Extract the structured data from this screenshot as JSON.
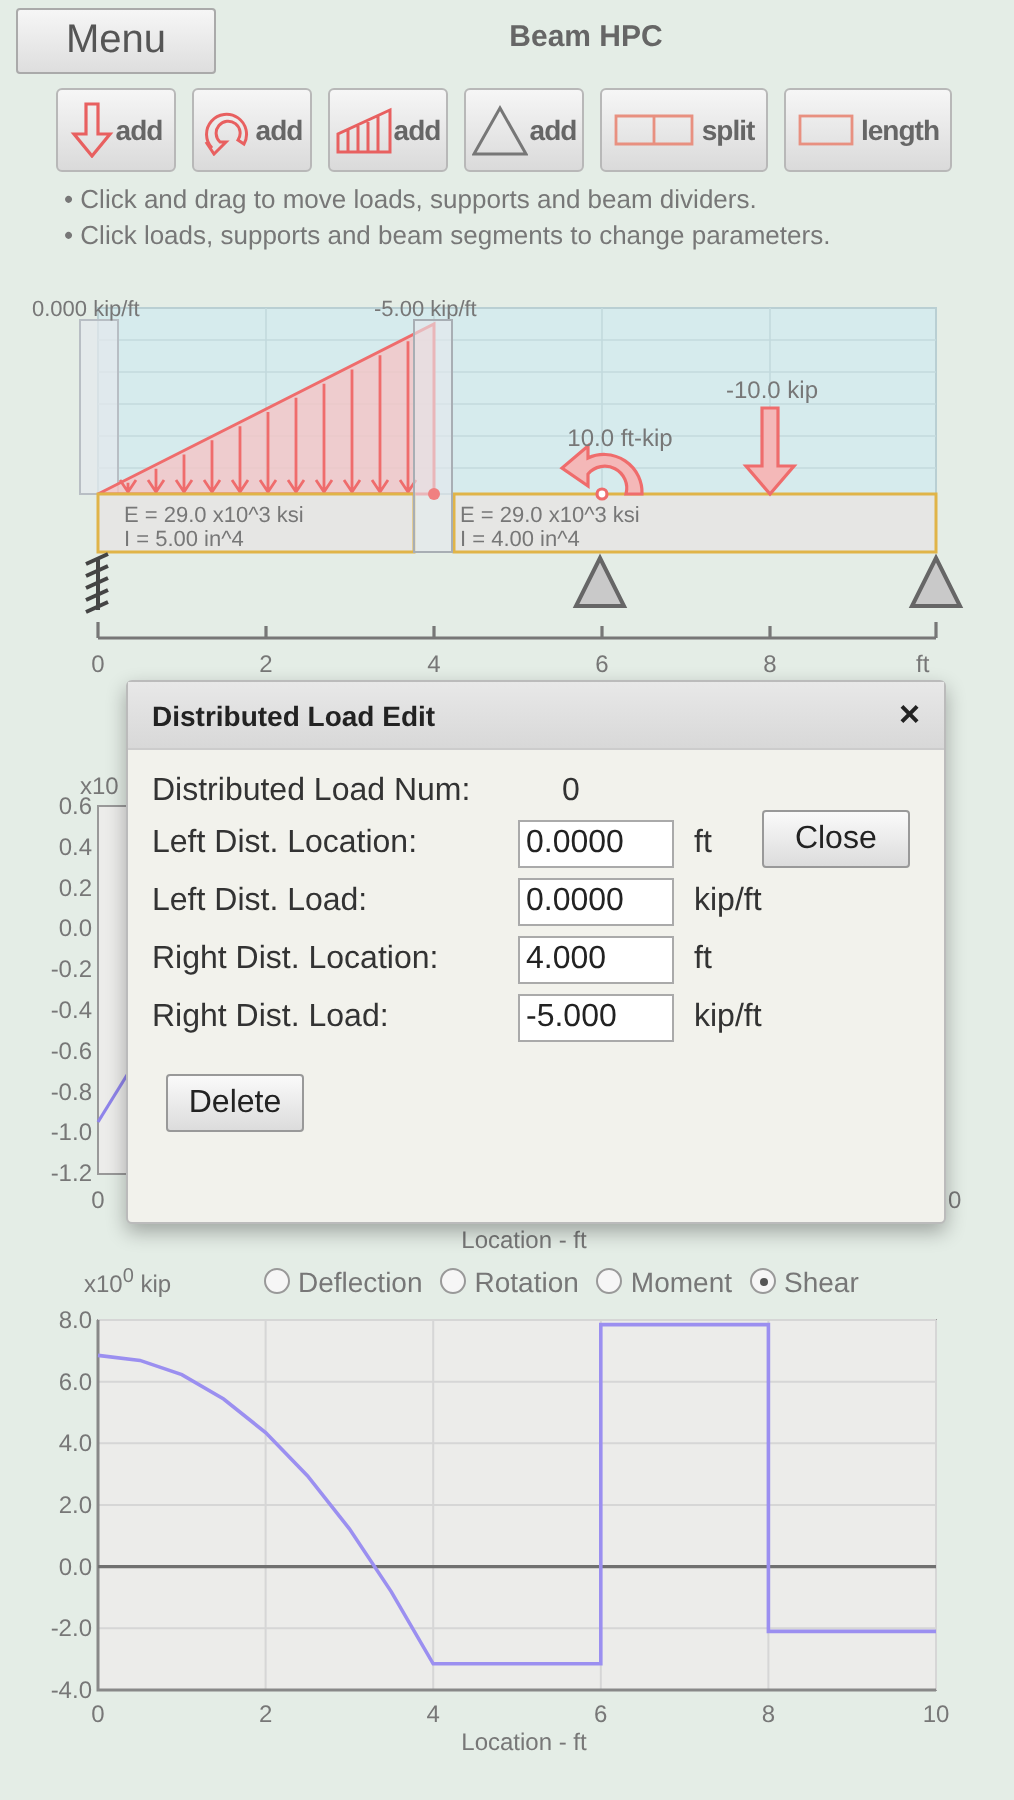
{
  "header": {
    "menu": "Menu",
    "title": "Beam HPC"
  },
  "tools": [
    {
      "kind": "point-load",
      "label": "add"
    },
    {
      "kind": "moment",
      "label": "add"
    },
    {
      "kind": "dist-load",
      "label": "add"
    },
    {
      "kind": "support",
      "label": "add"
    },
    {
      "kind": "split",
      "label": "split"
    },
    {
      "kind": "length",
      "label": "length"
    }
  ],
  "hints": [
    "• Click and drag to move loads, supports and beam dividers.",
    "• Click loads, supports and beam segments to change parameters."
  ],
  "beam": {
    "dist_load": {
      "left_label": "0.000 kip/ft",
      "right_label": "-5.00 kip/ft"
    },
    "moment": {
      "label": "10.0 ft-kip"
    },
    "point_load": {
      "label": "-10.0 kip"
    },
    "segments": [
      {
        "e": "E = 29.0 x10^3 ksi",
        "i": "I = 5.00 in^4"
      },
      {
        "e": "E = 29.0 x10^3 ksi",
        "i": "I = 4.00 in^4"
      }
    ],
    "supports": [
      {
        "kind": "fixed"
      },
      {
        "kind": "pin"
      },
      {
        "kind": "pin"
      }
    ],
    "axis_labels": [
      "0",
      "2",
      "4",
      "6",
      "8",
      "ft"
    ]
  },
  "upper_plot": {
    "scale_label": "x10",
    "y_labels": [
      "0.6",
      "0.4",
      "0.2",
      "0.0",
      "-0.2",
      "-0.4",
      "-0.6",
      "-0.8",
      "-1.0",
      "-1.2"
    ],
    "x_labels": [
      "0",
      "0"
    ],
    "xlabel": "Location - ft"
  },
  "dialog": {
    "title": "Distributed Load Edit",
    "close_icon": "×",
    "num_label": "Distributed Load Num:",
    "num": "0",
    "fields": [
      {
        "label": "Left Dist. Location:",
        "value": "0.0000",
        "unit": "ft"
      },
      {
        "label": "Left Dist. Load:",
        "value": "0.0000",
        "unit": "kip/ft"
      },
      {
        "label": "Right Dist. Location:",
        "value": "4.000",
        "unit": "ft"
      },
      {
        "label": "Right Dist. Load:",
        "value": "-5.000",
        "unit": "kip/ft"
      }
    ],
    "close": "Close",
    "delete": "Delete"
  },
  "result": {
    "options": [
      {
        "label": "Deflection",
        "selected": false
      },
      {
        "label": "Rotation",
        "selected": false
      },
      {
        "label": "Moment",
        "selected": false
      },
      {
        "label": "Shear",
        "selected": true
      }
    ],
    "chart_data": {
      "type": "line",
      "ylabel": "x10$^{0}$ kip",
      "xlabel": "Location - ft",
      "xlim": [
        0,
        10
      ],
      "ylim": [
        -4,
        8
      ],
      "xticks": [
        0,
        2,
        4,
        6,
        8,
        10
      ],
      "yticks": [
        {
          "value": 8,
          "label": "8.0"
        },
        {
          "value": 6,
          "label": "6.0"
        },
        {
          "value": 4,
          "label": "4.0"
        },
        {
          "value": 2,
          "label": "2.0"
        },
        {
          "value": 0,
          "label": "0.0"
        },
        {
          "value": -2,
          "label": "-2.0"
        },
        {
          "value": -4,
          "label": "-4.0"
        }
      ],
      "x": [
        0,
        0.5,
        1,
        1.5,
        2,
        2.5,
        3,
        3.5,
        4,
        6,
        6,
        8,
        8,
        10
      ],
      "grid": true,
      "series": [
        {
          "color": "#9b8ff0",
          "values": [
            6.85,
            6.69,
            6.23,
            5.44,
            4.35,
            2.94,
            1.23,
            -0.81,
            -3.15,
            -3.15,
            7.85,
            7.85,
            -2.1,
            -2.1
          ]
        }
      ]
    }
  }
}
